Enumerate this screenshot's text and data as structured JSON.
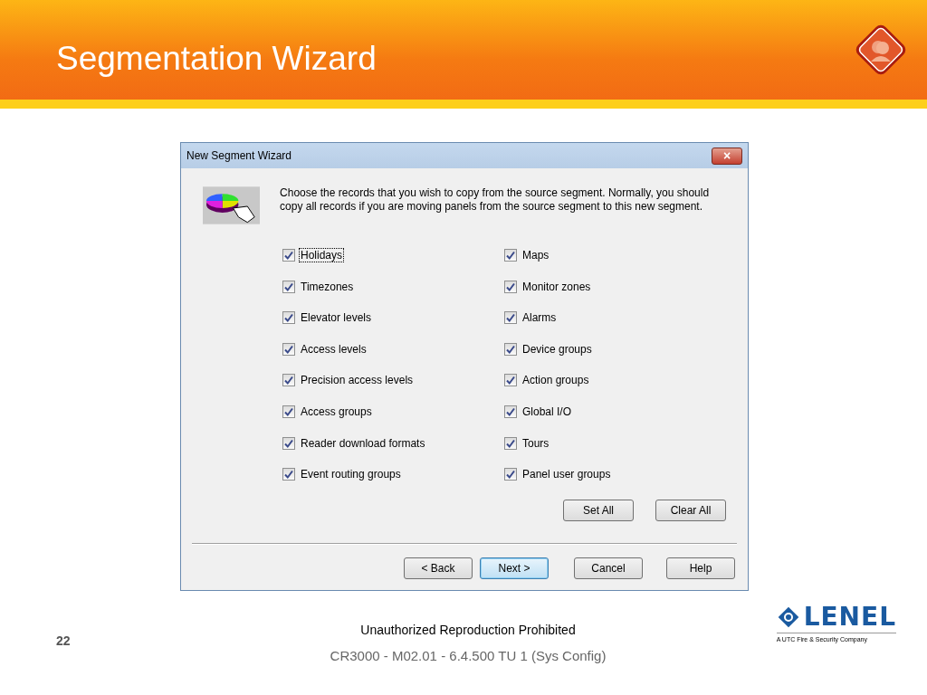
{
  "slide": {
    "title": "Segmentation Wizard",
    "page_number": "22",
    "notice": "Unauthorized Reproduction Prohibited",
    "course": "CR3000 - M02.01 - 6.4.500 TU 1 (Sys Config)",
    "logo": {
      "wordmark": "LENEL",
      "tagline": "A UTC Fire & Security Company"
    }
  },
  "dialog": {
    "title": "New Segment Wizard",
    "close": "×",
    "instructions": "Choose the records that you wish to copy from the source segment.  Normally, you should copy all records if you are moving panels from the source segment to this new segment.",
    "columns": [
      [
        {
          "label": "Holidays",
          "checked": true,
          "focused": true
        },
        {
          "label": "Timezones",
          "checked": true,
          "focused": false
        },
        {
          "label": "Elevator levels",
          "checked": true,
          "focused": false
        },
        {
          "label": "Access levels",
          "checked": true,
          "focused": false
        },
        {
          "label": "Precision access levels",
          "checked": true,
          "focused": false
        },
        {
          "label": "Access groups",
          "checked": true,
          "focused": false
        },
        {
          "label": "Reader download formats",
          "checked": true,
          "focused": false
        },
        {
          "label": "Event routing groups",
          "checked": true,
          "focused": false
        }
      ],
      [
        {
          "label": "Maps",
          "checked": true,
          "focused": false
        },
        {
          "label": "Monitor zones",
          "checked": true,
          "focused": false
        },
        {
          "label": "Alarms",
          "checked": true,
          "focused": false
        },
        {
          "label": "Device groups",
          "checked": true,
          "focused": false
        },
        {
          "label": "Action groups",
          "checked": true,
          "focused": false
        },
        {
          "label": "Global I/O",
          "checked": true,
          "focused": false
        },
        {
          "label": "Tours",
          "checked": true,
          "focused": false
        },
        {
          "label": "Panel user groups",
          "checked": true,
          "focused": false
        }
      ]
    ],
    "selection_buttons": [
      {
        "label": "Set All",
        "default": false
      },
      {
        "label": "Clear All",
        "default": false
      }
    ],
    "nav_buttons": [
      {
        "label": "< Back",
        "default": false
      },
      {
        "label": "Next >",
        "default": true
      },
      {
        "label": "Cancel",
        "default": false
      },
      {
        "label": "Help",
        "default": false
      }
    ]
  }
}
